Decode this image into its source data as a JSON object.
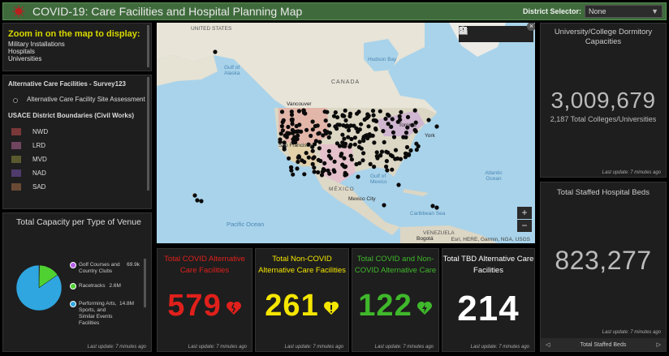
{
  "header": {
    "title": "COVID-19: Care Facilities and Hospital Planning Map",
    "selector_label": "District Selector:",
    "selector_value": "None"
  },
  "zoom_panel": {
    "heading": "Zoom in on the map to display:",
    "items": [
      "Military Installations",
      "Hospitals",
      "Universities"
    ]
  },
  "layers_panel": {
    "layer1_title": "Alternative Care Facilities - Survey123",
    "layer1_item": "Alternative Care Facility Site Assessment",
    "layer2_title": "USACE District Boundaries (Civil Works)",
    "districts": [
      {
        "label": "NWD",
        "color": "#7a3838"
      },
      {
        "label": "LRD",
        "color": "#6f4560"
      },
      {
        "label": "MVD",
        "color": "#5a5a2e"
      },
      {
        "label": "NAD",
        "color": "#4f3b6c"
      },
      {
        "label": "SAD",
        "color": "#6a4a35"
      }
    ]
  },
  "venue_panel": {
    "title": "Total Capacity per Type of Venue",
    "footer": "Last update: 7 minutes ago",
    "chart_data": {
      "type": "pie",
      "series": [
        {
          "name": "Golf Courses and Country Clubs",
          "value": 69900,
          "value_label": "69.9k",
          "color": "#b65ce6"
        },
        {
          "name": "Racetracks",
          "value": 2600000,
          "value_label": "2.6M",
          "color": "#4fd131"
        },
        {
          "name": "Performing Arts, Sports, and Similar Events Facilities",
          "value": 14800000,
          "value_label": "14.8M",
          "color": "#2fa6e0"
        }
      ],
      "legend_placement": "right"
    }
  },
  "map": {
    "labels": {
      "states": "UNITED STATES",
      "alaska": "Gulf of Alaska",
      "hudson": "Hudson Bay",
      "canada": "CANADA",
      "vancouver": "Vancouver",
      "sf": "San Francisco",
      "toronto": "Toronto",
      "ny": "York",
      "mexico": "MÉXICO",
      "mexcity": "Mexico City",
      "pacific": "Pacific Ocean",
      "atlantic": "Atlantic Ocean",
      "gulf": "Gulf of Mexico",
      "caribbean": "Caribbean Sea",
      "venezuela": "VENEZUELA",
      "bogota": "Bogotá"
    },
    "attribution": "Esri, HERE, Garmin, NGA, USGS",
    "esri": "esri",
    "zoom_in": "+",
    "zoom_out": "−",
    "close": "×"
  },
  "kpis": [
    {
      "title": "Total COVID Alternative Care Facilities",
      "value": "579",
      "color": "#e0201b",
      "footer": "Last update: 7 minutes ago"
    },
    {
      "title": "Total Non-COVID Alternative Care Facilities",
      "value": "261",
      "color": "#f5e600",
      "footer": "Last update: 7 minutes ago"
    },
    {
      "title": "Total COVID and Non-COVID Alternative Care",
      "value": "122",
      "color": "#3fb82b",
      "footer": "Last update: 7 minutes ago"
    },
    {
      "title": "Total TBD Alternative Care Facilities",
      "value": "214",
      "color": "#ffffff",
      "footer": "Last update: 7 minutes ago"
    }
  ],
  "university": {
    "title": "University/College Dormitory Capacities",
    "value": "3,009,679",
    "subtitle": "2,187 Total Colleges/Universities",
    "footer": "Last update: 7 minutes ago"
  },
  "hospital": {
    "title": "Total Staffed Hospital Beds",
    "value": "823,277",
    "footer": "Last update: 7 minutes ago",
    "nav_label": "Total Staffed Beds",
    "prev": "◁",
    "next": "▷"
  }
}
